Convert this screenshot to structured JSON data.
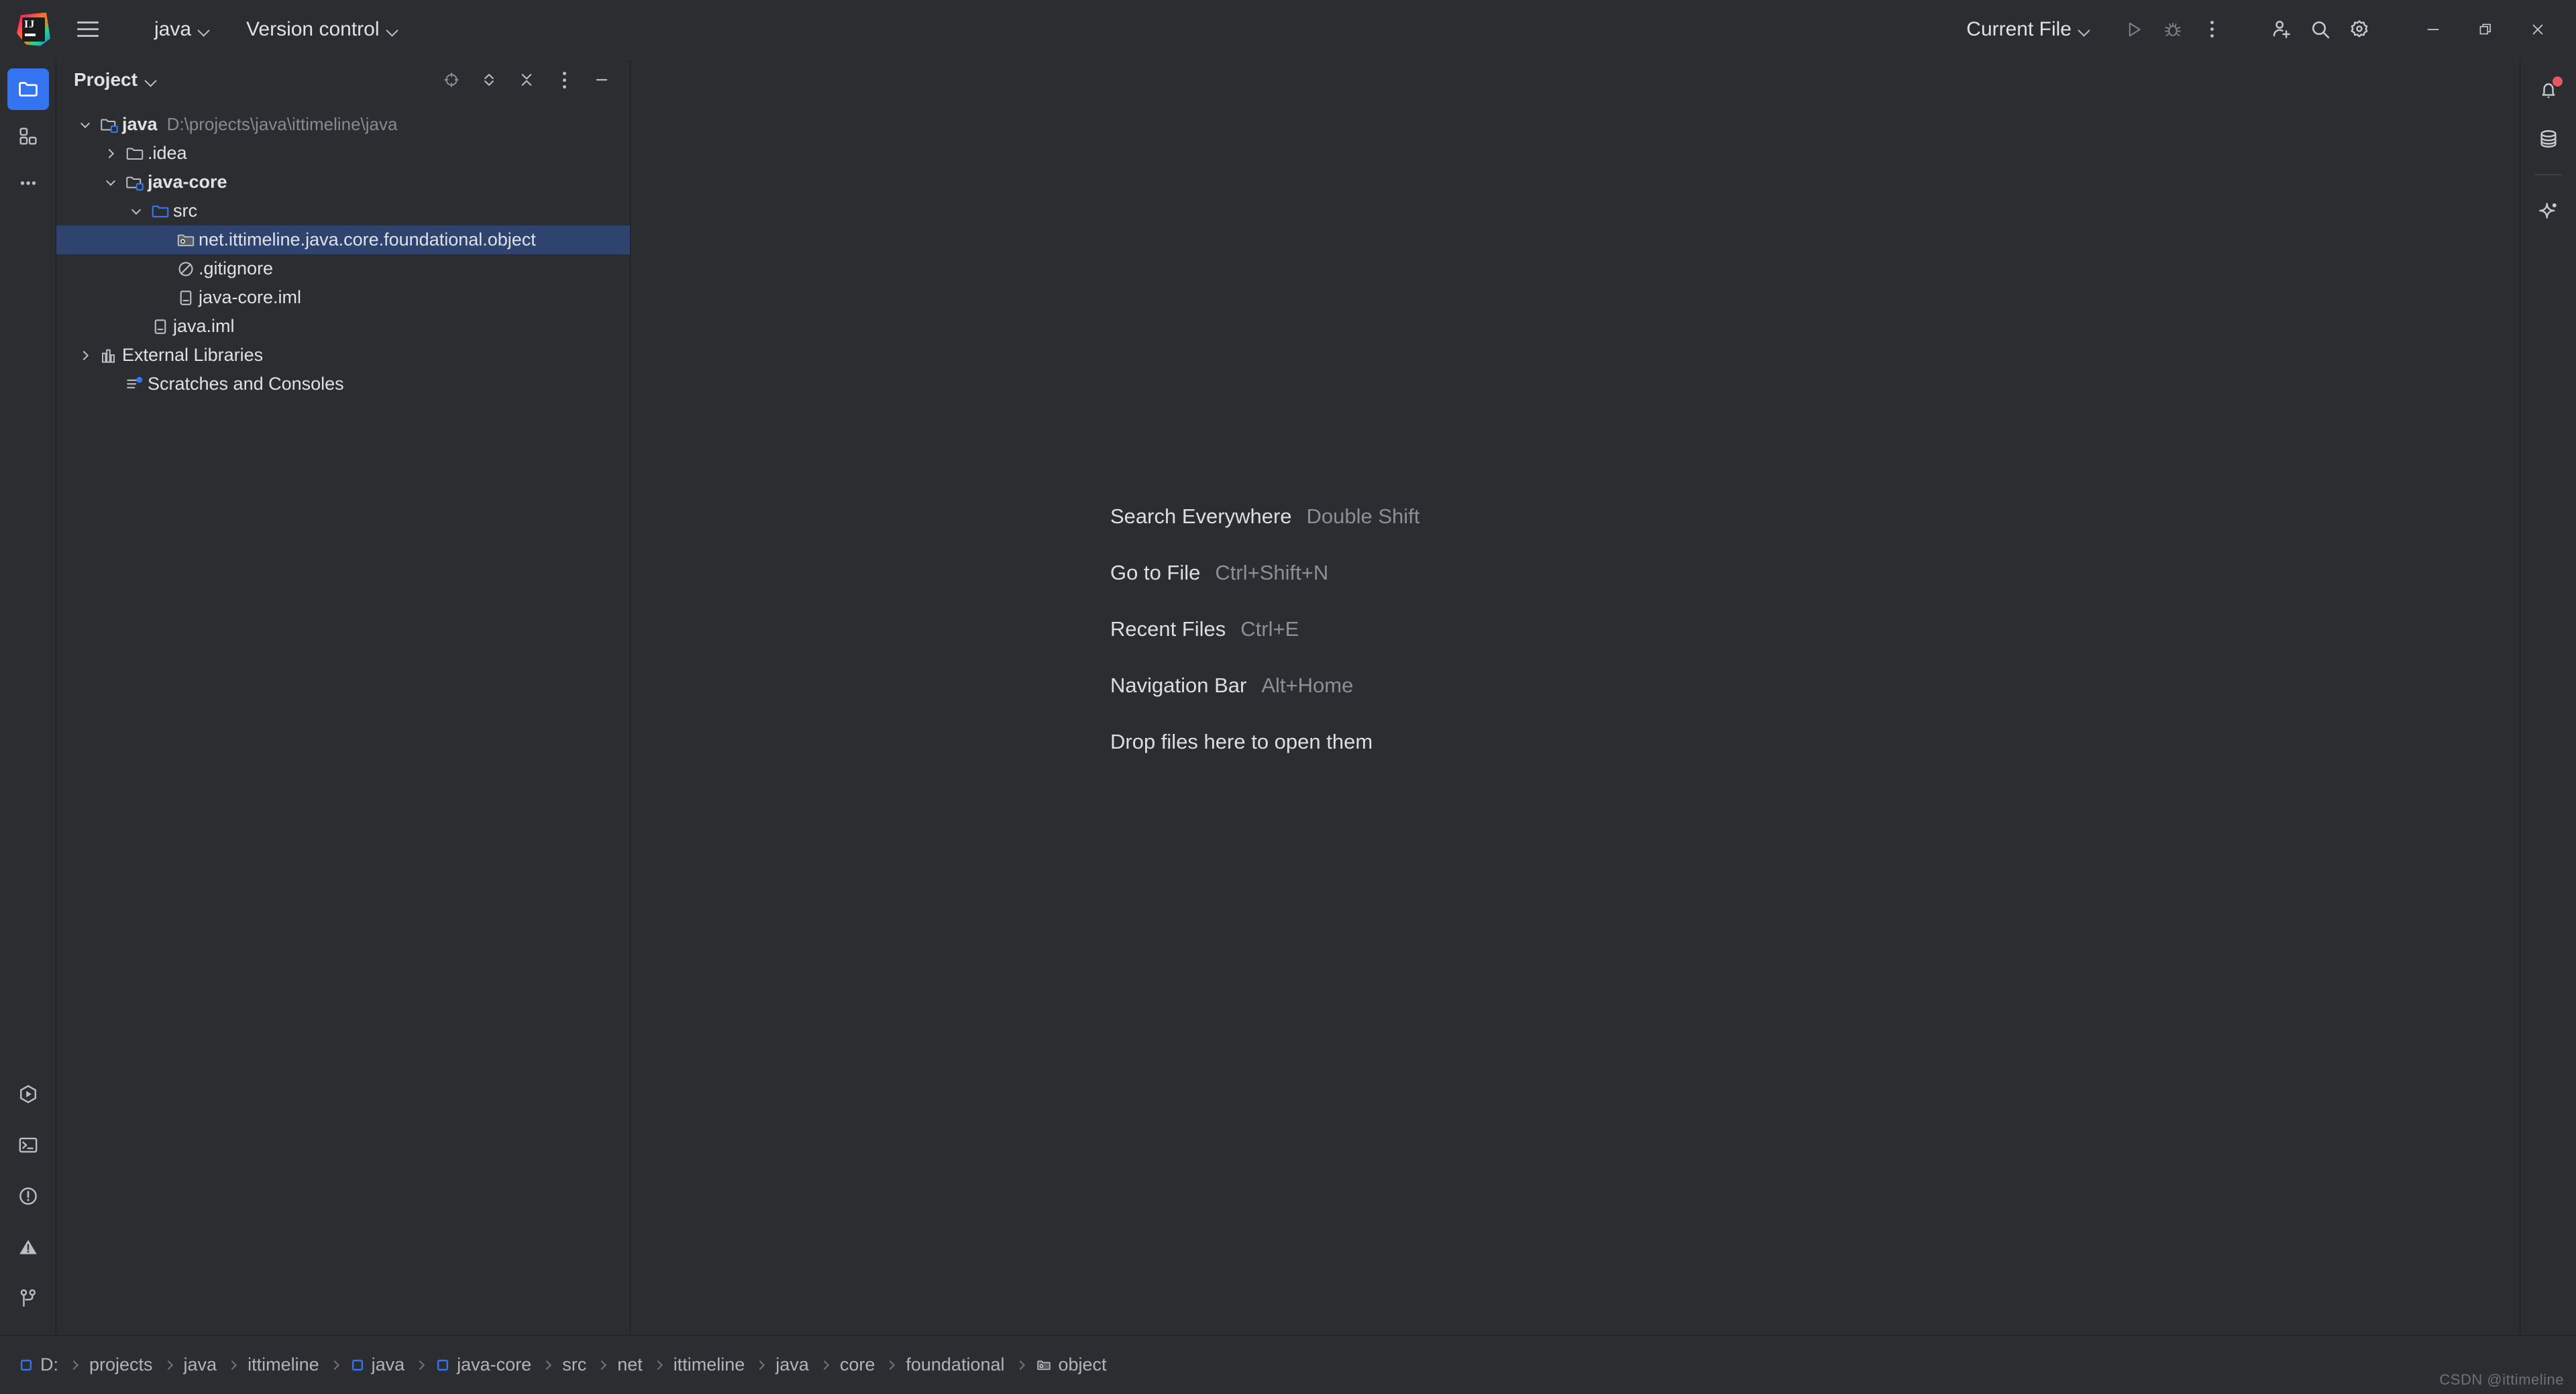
{
  "window": {
    "app_name": "IntelliJ IDEA",
    "logo_text": "IJ"
  },
  "titlebar": {
    "menu_icon": "hamburger-menu-icon",
    "project_name": "java",
    "version_control_label": "Version control",
    "run_config_label": "Current File",
    "run_icon": "run-icon",
    "debug_icon": "debug-icon",
    "more_icon": "more-vertical-icon",
    "add_user_icon": "add-user-icon",
    "search_icon": "search-icon",
    "settings_icon": "settings-gear-icon",
    "minimize_icon": "minimize-icon",
    "maximize_icon": "restore-icon",
    "close_icon": "close-icon"
  },
  "left_rail": {
    "top": [
      {
        "name": "project-tool-window",
        "icon": "folder-icon",
        "active": true
      },
      {
        "name": "structure-tool-window",
        "icon": "structure-icon",
        "active": false
      },
      {
        "name": "more-tool-windows",
        "icon": "ellipsis-icon",
        "active": false
      }
    ],
    "bottom": [
      {
        "name": "run-tool-window",
        "icon": "run-hex-icon"
      },
      {
        "name": "terminal-tool-window",
        "icon": "terminal-icon"
      },
      {
        "name": "problems-tool-window",
        "icon": "problems-circle-icon"
      },
      {
        "name": "warnings-tool-window",
        "icon": "warning-triangle-icon"
      },
      {
        "name": "version-control-tool-window",
        "icon": "branch-icon"
      }
    ]
  },
  "right_rail": {
    "items": [
      {
        "name": "notifications",
        "icon": "bell-icon",
        "badge": true
      },
      {
        "name": "database",
        "icon": "database-icon",
        "badge": false
      },
      {
        "name": "ai-assistant",
        "icon": "sparkle-icon",
        "badge": false
      }
    ]
  },
  "project_panel": {
    "title": "Project",
    "tools": [
      {
        "name": "select-opened-file-button",
        "icon": "crosshair-icon"
      },
      {
        "name": "expand-all-button",
        "icon": "expand-all-icon"
      },
      {
        "name": "collapse-all-button",
        "icon": "collapse-all-icon"
      },
      {
        "name": "options-button",
        "icon": "more-vertical-icon"
      },
      {
        "name": "hide-button",
        "icon": "minimize-icon"
      }
    ],
    "tree": [
      {
        "label": "java",
        "path": "D:\\projects\\java\\ittimeline\\java",
        "indent": 0,
        "twisty": "down",
        "icon": "module-folder-icon",
        "bold": true,
        "selected": false
      },
      {
        "label": ".idea",
        "path": "",
        "indent": 1,
        "twisty": "right",
        "icon": "folder-icon",
        "bold": false,
        "selected": false
      },
      {
        "label": "java-core",
        "path": "",
        "indent": 1,
        "twisty": "down",
        "icon": "module-folder-icon",
        "bold": true,
        "selected": false
      },
      {
        "label": "src",
        "path": "",
        "indent": 2,
        "twisty": "down",
        "icon": "source-folder-icon",
        "bold": false,
        "selected": false
      },
      {
        "label": "net.ittimeline.java.core.foundational.object",
        "path": "",
        "indent": 3,
        "twisty": "none",
        "icon": "package-icon",
        "bold": false,
        "selected": true
      },
      {
        "label": ".gitignore",
        "path": "",
        "indent": 3,
        "twisty": "none",
        "icon": "gitignore-icon",
        "bold": false,
        "selected": false
      },
      {
        "label": "java-core.iml",
        "path": "",
        "indent": 3,
        "twisty": "none",
        "icon": "iml-file-icon",
        "bold": false,
        "selected": false
      },
      {
        "label": "java.iml",
        "path": "",
        "indent": 2,
        "twisty": "none",
        "icon": "iml-file-icon",
        "bold": false,
        "selected": false
      },
      {
        "label": "External Libraries",
        "path": "",
        "indent": 0,
        "twisty": "right",
        "icon": "libraries-icon",
        "bold": false,
        "selected": false
      },
      {
        "label": "Scratches and Consoles",
        "path": "",
        "indent": 1,
        "twisty": "none",
        "icon": "scratches-icon",
        "bold": false,
        "selected": false
      }
    ]
  },
  "editor": {
    "hints": [
      {
        "action": "Search Everywhere",
        "shortcut": "Double Shift"
      },
      {
        "action": "Go to File",
        "shortcut": "Ctrl+Shift+N"
      },
      {
        "action": "Recent Files",
        "shortcut": "Ctrl+E"
      },
      {
        "action": "Navigation Bar",
        "shortcut": "Alt+Home"
      },
      {
        "action": "Drop files here to open them",
        "shortcut": ""
      }
    ]
  },
  "statusbar": {
    "breadcrumbs": [
      {
        "label": "D:",
        "icon": "drive-icon"
      },
      {
        "label": "projects",
        "icon": ""
      },
      {
        "label": "java",
        "icon": ""
      },
      {
        "label": "ittimeline",
        "icon": ""
      },
      {
        "label": "java",
        "icon": "module-icon"
      },
      {
        "label": "java-core",
        "icon": "module-icon"
      },
      {
        "label": "src",
        "icon": ""
      },
      {
        "label": "net",
        "icon": ""
      },
      {
        "label": "ittimeline",
        "icon": ""
      },
      {
        "label": "java",
        "icon": ""
      },
      {
        "label": "core",
        "icon": ""
      },
      {
        "label": "foundational",
        "icon": ""
      },
      {
        "label": "object",
        "icon": "package-icon"
      }
    ],
    "watermark": "CSDN @ittimeline"
  },
  "colors": {
    "background": "#2b2d30",
    "selection": "#2e436e",
    "accent": "#3574f0",
    "text": "#dfe1e5",
    "muted": "#868a91",
    "badge": "#e55765"
  }
}
